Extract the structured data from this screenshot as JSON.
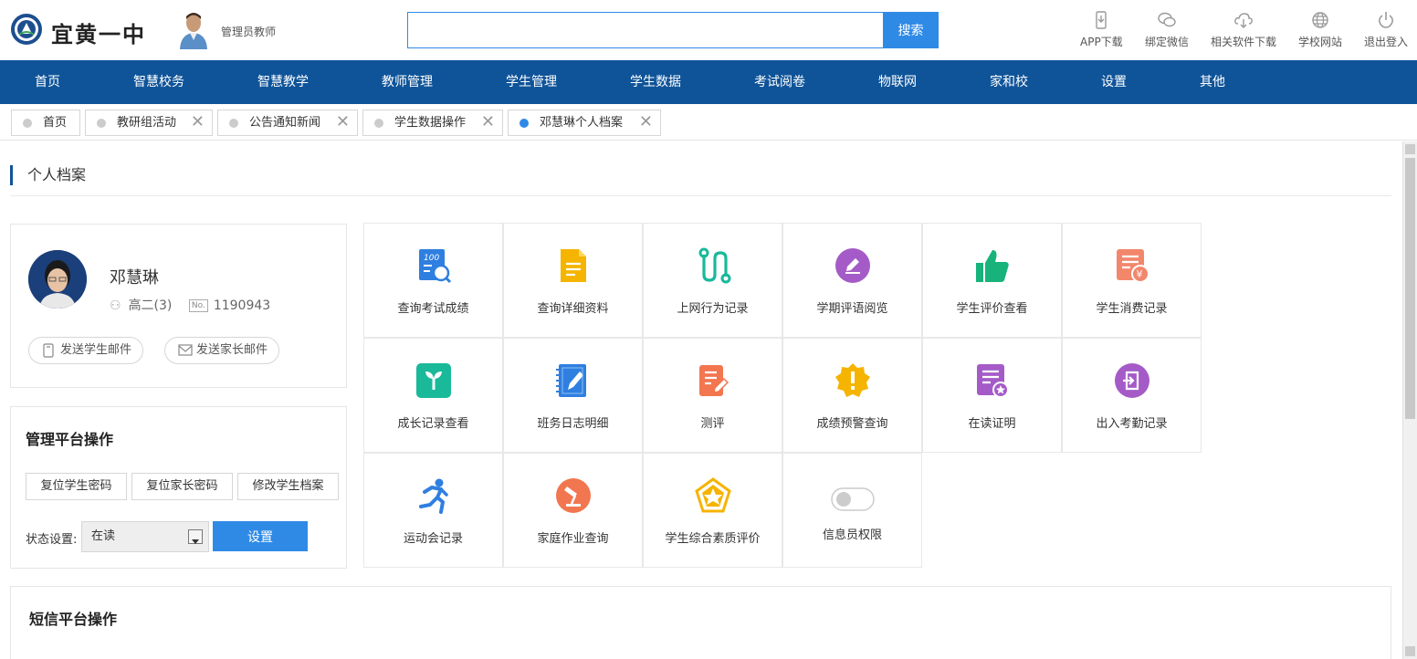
{
  "header": {
    "school_name": "宜黄一中",
    "admin_label": "管理员教师",
    "search_placeholder": "",
    "search_button": "搜索",
    "tools": [
      {
        "label": "APP下载",
        "icon": "phone-download-icon"
      },
      {
        "label": "绑定微信",
        "icon": "wechat-icon"
      },
      {
        "label": "相关软件下载",
        "icon": "cloud-download-icon"
      },
      {
        "label": "学校网站",
        "icon": "globe-icon"
      },
      {
        "label": "退出登入",
        "icon": "power-icon"
      }
    ]
  },
  "nav": [
    "首页",
    "智慧校务",
    "智慧教学",
    "教师管理",
    "学生管理",
    "学生数据",
    "考试阅卷",
    "物联网",
    "家和校",
    "设置",
    "其他"
  ],
  "tabs": [
    {
      "label": "首页",
      "closable": false,
      "active": false
    },
    {
      "label": "教研组活动",
      "closable": true,
      "active": false
    },
    {
      "label": "公告通知新闻",
      "closable": true,
      "active": false
    },
    {
      "label": "学生数据操作",
      "closable": true,
      "active": false
    },
    {
      "label": "邓慧琳个人档案",
      "closable": true,
      "active": true
    }
  ],
  "page": {
    "section_title": "个人档案"
  },
  "profile": {
    "name": "邓慧琳",
    "class": "高二(3)",
    "number": "1190943",
    "send_student_mail": "发送学生邮件",
    "send_parent_mail": "发送家长邮件"
  },
  "admin": {
    "title": "管理平台操作",
    "buttons": [
      "复位学生密码",
      "复位家长密码",
      "修改学生档案"
    ],
    "status_label": "状态设置:",
    "status_value": "在读",
    "set_button": "设置"
  },
  "functions": [
    {
      "label": "查询考试成绩",
      "icon": "exam-score-icon",
      "color": "#2f7fe0"
    },
    {
      "label": "查询详细资料",
      "icon": "document-icon",
      "color": "#f5b400"
    },
    {
      "label": "上网行为记录",
      "icon": "route-icon",
      "color": "#19b99a"
    },
    {
      "label": "学期评语阅览",
      "icon": "pen-circle-icon",
      "color": "#a45bc7"
    },
    {
      "label": "学生评价查看",
      "icon": "thumbs-up-icon",
      "color": "#17b37a"
    },
    {
      "label": "学生消费记录",
      "icon": "receipt-yen-icon",
      "color": "#f2876b"
    },
    {
      "label": "成长记录查看",
      "icon": "sprout-icon",
      "color": "#19b99a"
    },
    {
      "label": "班务日志明细",
      "icon": "notebook-icon",
      "color": "#2f7fe0"
    },
    {
      "label": "测评",
      "icon": "checklist-pen-icon",
      "color": "#f2764f"
    },
    {
      "label": "成绩预警查询",
      "icon": "warning-badge-icon",
      "color": "#f5b400"
    },
    {
      "label": "在读证明",
      "icon": "certificate-icon",
      "color": "#a45bc7"
    },
    {
      "label": "出入考勤记录",
      "icon": "door-exit-icon",
      "color": "#a45bc7"
    },
    {
      "label": "运动会记录",
      "icon": "runner-icon",
      "color": "#2f7fe0"
    },
    {
      "label": "家庭作业查询",
      "icon": "desk-lamp-icon",
      "color": "#f2764f"
    },
    {
      "label": "学生综合素质评价",
      "icon": "pentagon-star-icon",
      "color": "#f5b400"
    },
    {
      "label": "信息员权限",
      "icon": "toggle-icon",
      "color": "#cccccc"
    }
  ],
  "sms": {
    "title": "短信平台操作"
  }
}
